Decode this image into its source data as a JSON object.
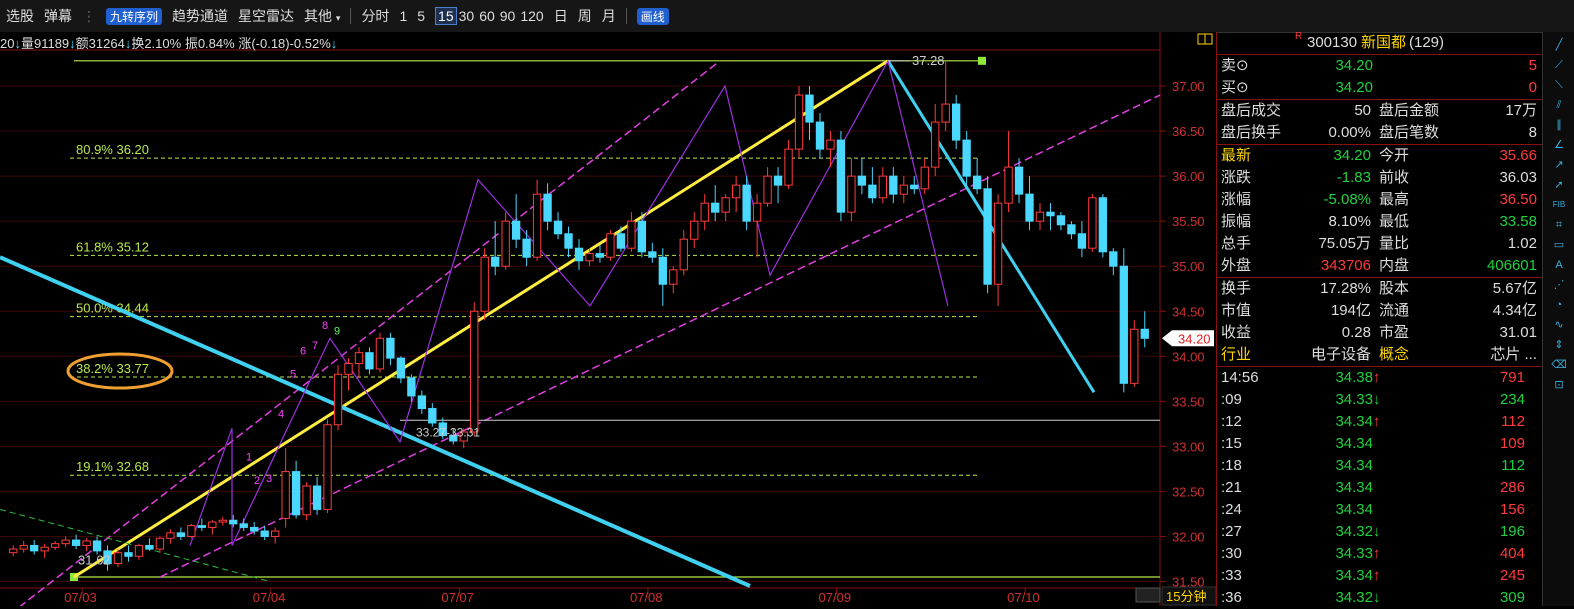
{
  "toolbar": {
    "items": [
      "选股",
      "弹幕",
      "九转序列",
      "趋势通道",
      "星空雷达",
      "其他",
      "分时",
      "1",
      "5",
      "15",
      "30",
      "60",
      "90",
      "120",
      "日",
      "周",
      "月",
      "画线"
    ]
  },
  "info_line": {
    "volume": "量91189",
    "amount": "额31264",
    "turnover": "换2.10%",
    "amplitude": "振0.84%",
    "change": "涨(-0.18)-0.52%",
    "prefix": "20"
  },
  "chart_data": {
    "type": "candlestick",
    "period_label": "15分钟",
    "ylim": [
      31.45,
      37.6
    ],
    "y_ticks": [
      "37.00",
      "36.50",
      "36.00",
      "35.50",
      "35.00",
      "34.50",
      "34.00",
      "33.50",
      "33.00",
      "32.50",
      "32.00",
      "31.50"
    ],
    "x_ticks": [
      "07/03",
      "07/04",
      "07/07",
      "07/08",
      "07/09",
      "07/10"
    ],
    "fib_levels": [
      {
        "label": "80.9% 36.20",
        "value": 36.2
      },
      {
        "label": "61.8% 35.12",
        "value": 35.12
      },
      {
        "label": "50.0% 34.44",
        "value": 34.44
      },
      {
        "label": "38.2% 33.77",
        "value": 33.77
      },
      {
        "label": "19.1% 32.68",
        "value": 32.68
      }
    ],
    "annotations": {
      "high": "37.28",
      "low": "31.62",
      "zone": "33.27-33.31",
      "current": "34.20"
    },
    "td_sequence": [
      "1",
      "2",
      "3",
      "4",
      "5",
      "6",
      "7",
      "8",
      "9"
    ],
    "candles": [
      [
        31.82,
        31.9,
        31.78,
        31.86
      ],
      [
        31.86,
        31.95,
        31.82,
        31.9
      ],
      [
        31.9,
        31.96,
        31.8,
        31.84
      ],
      [
        31.84,
        31.92,
        31.76,
        31.88
      ],
      [
        31.88,
        31.95,
        31.85,
        31.92
      ],
      [
        31.92,
        32.0,
        31.88,
        31.96
      ],
      [
        31.96,
        32.02,
        31.86,
        31.9
      ],
      [
        31.9,
        31.98,
        31.84,
        31.95
      ],
      [
        31.95,
        32.0,
        31.8,
        31.84
      ],
      [
        31.84,
        31.9,
        31.62,
        31.7
      ],
      [
        31.7,
        31.86,
        31.66,
        31.82
      ],
      [
        31.82,
        31.9,
        31.72,
        31.78
      ],
      [
        31.78,
        31.92,
        31.74,
        31.9
      ],
      [
        31.9,
        31.98,
        31.84,
        31.86
      ],
      [
        31.86,
        32.0,
        31.82,
        31.98
      ],
      [
        31.98,
        32.08,
        31.92,
        32.04
      ],
      [
        32.04,
        32.1,
        31.96,
        32.0
      ],
      [
        32.0,
        32.14,
        31.98,
        32.12
      ],
      [
        32.12,
        32.2,
        32.06,
        32.1
      ],
      [
        32.1,
        32.18,
        32.02,
        32.16
      ],
      [
        32.16,
        32.22,
        32.12,
        32.18
      ],
      [
        32.18,
        32.24,
        32.1,
        32.14
      ],
      [
        32.14,
        32.2,
        32.06,
        32.1
      ],
      [
        32.1,
        32.16,
        32.02,
        32.06
      ],
      [
        32.06,
        32.12,
        31.96,
        32.0
      ],
      [
        32.0,
        32.1,
        31.92,
        32.06
      ],
      [
        32.2,
        32.98,
        32.1,
        32.72
      ],
      [
        32.72,
        32.84,
        32.2,
        32.24
      ],
      [
        32.24,
        32.6,
        32.18,
        32.56
      ],
      [
        32.56,
        32.66,
        32.24,
        32.3
      ],
      [
        32.3,
        33.3,
        32.26,
        33.24
      ],
      [
        33.24,
        33.9,
        33.18,
        33.8
      ],
      [
        33.8,
        33.98,
        33.62,
        33.92
      ],
      [
        33.92,
        34.1,
        33.76,
        34.04
      ],
      [
        34.04,
        34.1,
        33.8,
        33.86
      ],
      [
        33.86,
        34.26,
        33.82,
        34.2
      ],
      [
        34.2,
        34.26,
        33.9,
        33.98
      ],
      [
        33.98,
        34.0,
        33.7,
        33.76
      ],
      [
        33.76,
        33.8,
        33.5,
        33.56
      ],
      [
        33.56,
        33.62,
        33.36,
        33.42
      ],
      [
        33.42,
        33.48,
        33.22,
        33.26
      ],
      [
        33.26,
        33.32,
        33.08,
        33.12
      ],
      [
        33.12,
        33.2,
        33.02,
        33.06
      ],
      [
        33.06,
        33.2,
        32.98,
        33.16
      ],
      [
        33.16,
        34.6,
        33.12,
        34.5
      ],
      [
        34.5,
        35.2,
        34.4,
        35.1
      ],
      [
        35.1,
        35.5,
        34.9,
        35.0
      ],
      [
        35.0,
        35.6,
        34.96,
        35.5
      ],
      [
        35.5,
        35.8,
        35.2,
        35.3
      ],
      [
        35.3,
        35.4,
        35.0,
        35.1
      ],
      [
        35.1,
        35.96,
        35.06,
        35.8
      ],
      [
        35.8,
        35.92,
        35.4,
        35.5
      ],
      [
        35.5,
        35.6,
        35.3,
        35.36
      ],
      [
        35.36,
        35.44,
        35.1,
        35.2
      ],
      [
        35.2,
        35.3,
        34.96,
        35.06
      ],
      [
        35.06,
        35.2,
        35.0,
        35.14
      ],
      [
        35.14,
        35.24,
        35.04,
        35.1
      ],
      [
        35.1,
        35.4,
        35.06,
        35.36
      ],
      [
        35.36,
        35.44,
        35.16,
        35.2
      ],
      [
        35.2,
        35.6,
        35.16,
        35.5
      ],
      [
        35.5,
        35.6,
        35.1,
        35.16
      ],
      [
        35.16,
        35.26,
        35.04,
        35.1
      ],
      [
        35.1,
        35.2,
        34.56,
        34.8
      ],
      [
        34.8,
        35.0,
        34.7,
        34.96
      ],
      [
        34.96,
        35.4,
        34.9,
        35.3
      ],
      [
        35.3,
        35.6,
        35.2,
        35.5
      ],
      [
        35.5,
        35.8,
        35.4,
        35.7
      ],
      [
        35.7,
        35.9,
        35.5,
        35.6
      ],
      [
        35.6,
        35.8,
        35.5,
        35.76
      ],
      [
        35.76,
        36.0,
        35.6,
        35.9
      ],
      [
        35.9,
        36.0,
        35.4,
        35.5
      ],
      [
        35.5,
        35.8,
        35.1,
        35.7
      ],
      [
        35.7,
        36.1,
        35.66,
        36.0
      ],
      [
        36.0,
        36.1,
        35.7,
        35.9
      ],
      [
        35.9,
        36.4,
        35.86,
        36.3
      ],
      [
        36.3,
        37.0,
        36.2,
        36.9
      ],
      [
        36.9,
        37.0,
        36.4,
        36.6
      ],
      [
        36.6,
        36.7,
        36.2,
        36.3
      ],
      [
        36.3,
        36.5,
        36.1,
        36.4
      ],
      [
        36.4,
        36.5,
        35.5,
        35.6
      ],
      [
        35.6,
        36.2,
        35.5,
        36.0
      ],
      [
        36.0,
        36.2,
        35.8,
        35.9
      ],
      [
        35.9,
        36.1,
        35.7,
        35.76
      ],
      [
        35.76,
        36.1,
        35.7,
        36.0
      ],
      [
        36.0,
        36.1,
        35.7,
        35.8
      ],
      [
        35.8,
        36.0,
        35.7,
        35.9
      ],
      [
        35.9,
        36.0,
        35.8,
        35.86
      ],
      [
        35.86,
        36.2,
        35.8,
        36.1
      ],
      [
        36.1,
        36.8,
        36.0,
        36.6
      ],
      [
        36.6,
        37.28,
        36.5,
        36.8
      ],
      [
        36.8,
        36.9,
        36.3,
        36.4
      ],
      [
        36.4,
        36.5,
        35.9,
        36.0
      ],
      [
        36.0,
        36.2,
        35.8,
        35.86
      ],
      [
        35.86,
        36.0,
        34.7,
        34.8
      ],
      [
        34.8,
        35.8,
        34.56,
        35.7
      ],
      [
        35.7,
        36.5,
        35.6,
        36.1
      ],
      [
        36.1,
        36.2,
        35.7,
        35.8
      ],
      [
        35.8,
        36.0,
        35.4,
        35.5
      ],
      [
        35.5,
        35.7,
        35.4,
        35.6
      ],
      [
        35.6,
        35.7,
        35.4,
        35.56
      ],
      [
        35.56,
        35.6,
        35.4,
        35.46
      ],
      [
        35.46,
        35.5,
        35.3,
        35.36
      ],
      [
        35.36,
        35.5,
        35.1,
        35.2
      ],
      [
        35.2,
        35.8,
        35.16,
        35.76
      ],
      [
        35.76,
        35.8,
        35.1,
        35.16
      ],
      [
        35.16,
        35.2,
        34.9,
        35.0
      ],
      [
        35.0,
        35.2,
        33.6,
        33.7
      ],
      [
        33.7,
        34.4,
        33.66,
        34.3
      ],
      [
        34.3,
        34.5,
        34.1,
        34.2
      ]
    ]
  },
  "stock": {
    "badge": "R",
    "code": "300130",
    "name": "新国都",
    "num": "(129)"
  },
  "orders": [
    {
      "label": "卖",
      "price": "34.20",
      "vol": "5"
    },
    {
      "label": "买",
      "price": "34.20",
      "vol": "0"
    }
  ],
  "after_hours": [
    {
      "l1": "盘后成交",
      "v1": "50",
      "l2": "盘后金额",
      "v2": "17万"
    },
    {
      "l1": "盘后换手",
      "v1": "0.00%",
      "l2": "盘后笔数",
      "v2": "8"
    }
  ],
  "quote": [
    {
      "l1": "最新",
      "v1": "34.20",
      "c1": "green",
      "l2": "今开",
      "v2": "35.66",
      "c2": "red"
    },
    {
      "l1": "涨跌",
      "v1": "-1.83",
      "c1": "green",
      "l2": "前收",
      "v2": "36.03",
      "c2": "white"
    },
    {
      "l1": "涨幅",
      "v1": "-5.08%",
      "c1": "green",
      "l2": "最高",
      "v2": "36.50",
      "c2": "red"
    },
    {
      "l1": "振幅",
      "v1": "8.10%",
      "c1": "white",
      "l2": "最低",
      "v2": "33.58",
      "c2": "green"
    },
    {
      "l1": "总手",
      "v1": "75.05万",
      "c1": "white",
      "l2": "量比",
      "v2": "1.02",
      "c2": "white"
    },
    {
      "l1": "外盘",
      "v1": "343706",
      "c1": "red",
      "l2": "内盘",
      "v2": "406601",
      "c2": "green"
    }
  ],
  "fundamentals": [
    {
      "l1": "换手",
      "v1": "17.28%",
      "l2": "股本",
      "v2": "5.67亿"
    },
    {
      "l1": "市值",
      "v1": "194亿",
      "l2": "流通",
      "v2": "4.34亿"
    },
    {
      "l1": "收益",
      "v1": "0.28",
      "l2": "市盈",
      "v2": "31.01"
    },
    {
      "l1": "行业",
      "v1": "电子设备",
      "l2": "概念",
      "v2": "芯片 ..."
    }
  ],
  "ticks": [
    {
      "t": "14:56",
      "p": "34.38",
      "a": "↑",
      "v": "791",
      "c": "red"
    },
    {
      "t": ":09",
      "p": "34.33",
      "a": "↓",
      "v": "234",
      "c": "green"
    },
    {
      "t": ":12",
      "p": "34.34",
      "a": "↑",
      "v": "112",
      "c": "red"
    },
    {
      "t": ":15",
      "p": "34.34",
      "a": "",
      "v": "109",
      "c": "red"
    },
    {
      "t": ":18",
      "p": "34.34",
      "a": "",
      "v": "112",
      "c": "green"
    },
    {
      "t": ":21",
      "p": "34.34",
      "a": "",
      "v": "286",
      "c": "red"
    },
    {
      "t": ":24",
      "p": "34.34",
      "a": "",
      "v": "156",
      "c": "red"
    },
    {
      "t": ":27",
      "p": "34.32",
      "a": "↓",
      "v": "196",
      "c": "green"
    },
    {
      "t": ":30",
      "p": "34.33",
      "a": "↑",
      "v": "404",
      "c": "red"
    },
    {
      "t": ":33",
      "p": "34.34",
      "a": "↑",
      "v": "245",
      "c": "red"
    },
    {
      "t": ":36",
      "p": "34.32",
      "a": "↓",
      "v": "309",
      "c": "green"
    }
  ],
  "right_tools": [
    "line-tool-icon",
    "ray-tool-icon",
    "segment-tool-icon",
    "channel-tool-icon",
    "parallel-tool-icon",
    "angle-tool-icon",
    "trend-tool-icon",
    "arrow-tool-icon",
    "fib-tool-icon",
    "gann-tool-icon",
    "box-tool-icon",
    "text-tool-icon",
    "fib-fan-icon",
    "cycle-tool-icon",
    "wave-tool-icon",
    "measure-tool-icon",
    "eraser-icon",
    "lock-icon"
  ],
  "colors": {
    "up": "#ff3b3b",
    "down": "#4ad8ff",
    "fib": "#b8e84a",
    "channel": "#e040e0",
    "trend": "#ffee40",
    "cyan_line": "#40d0f0"
  }
}
